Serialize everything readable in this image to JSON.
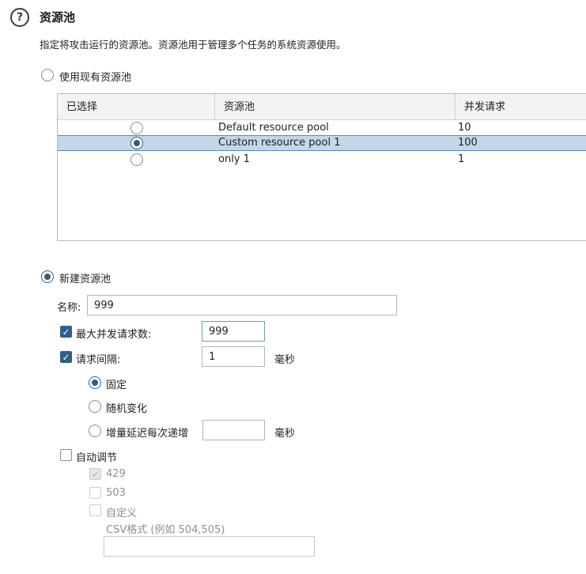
{
  "header": {
    "title": "资源池",
    "description": "指定将攻击运行的资源池。资源池用于管理多个任务的系统资源使用。"
  },
  "use_existing": {
    "label": "使用现有资源池",
    "selected": false
  },
  "pool_table": {
    "columns": [
      "已选择",
      "资源池",
      "并发请求"
    ],
    "rows": [
      {
        "selected": false,
        "name": "Default resource pool",
        "concurrent": "10"
      },
      {
        "selected": true,
        "name": "Custom resource pool 1",
        "concurrent": "100"
      },
      {
        "selected": false,
        "name": "only 1",
        "concurrent": "1"
      }
    ]
  },
  "create_new": {
    "label": "新建资源池",
    "selected": true,
    "name_label": "名称:",
    "name_value": "999",
    "max_concurrent": {
      "label": "最大并发请求数:",
      "checked": true,
      "value": "999"
    },
    "request_delay": {
      "label": "请求间隔:",
      "checked": true,
      "value": "1",
      "unit": "毫秒",
      "options": {
        "fixed": {
          "label": "固定",
          "selected": true
        },
        "random": {
          "label": "随机变化",
          "selected": false
        },
        "increment": {
          "label": "增量延迟每次递增",
          "selected": false,
          "value": "",
          "unit": "毫秒"
        }
      }
    },
    "auto_throttle": {
      "label": "自动调节",
      "checked": false,
      "codes": [
        {
          "label": "429",
          "checked": true
        },
        {
          "label": "503",
          "checked": false
        },
        {
          "label": "自定义",
          "checked": false
        }
      ],
      "csv_label": "CSV格式 (例如 504,505)",
      "csv_value": ""
    }
  }
}
